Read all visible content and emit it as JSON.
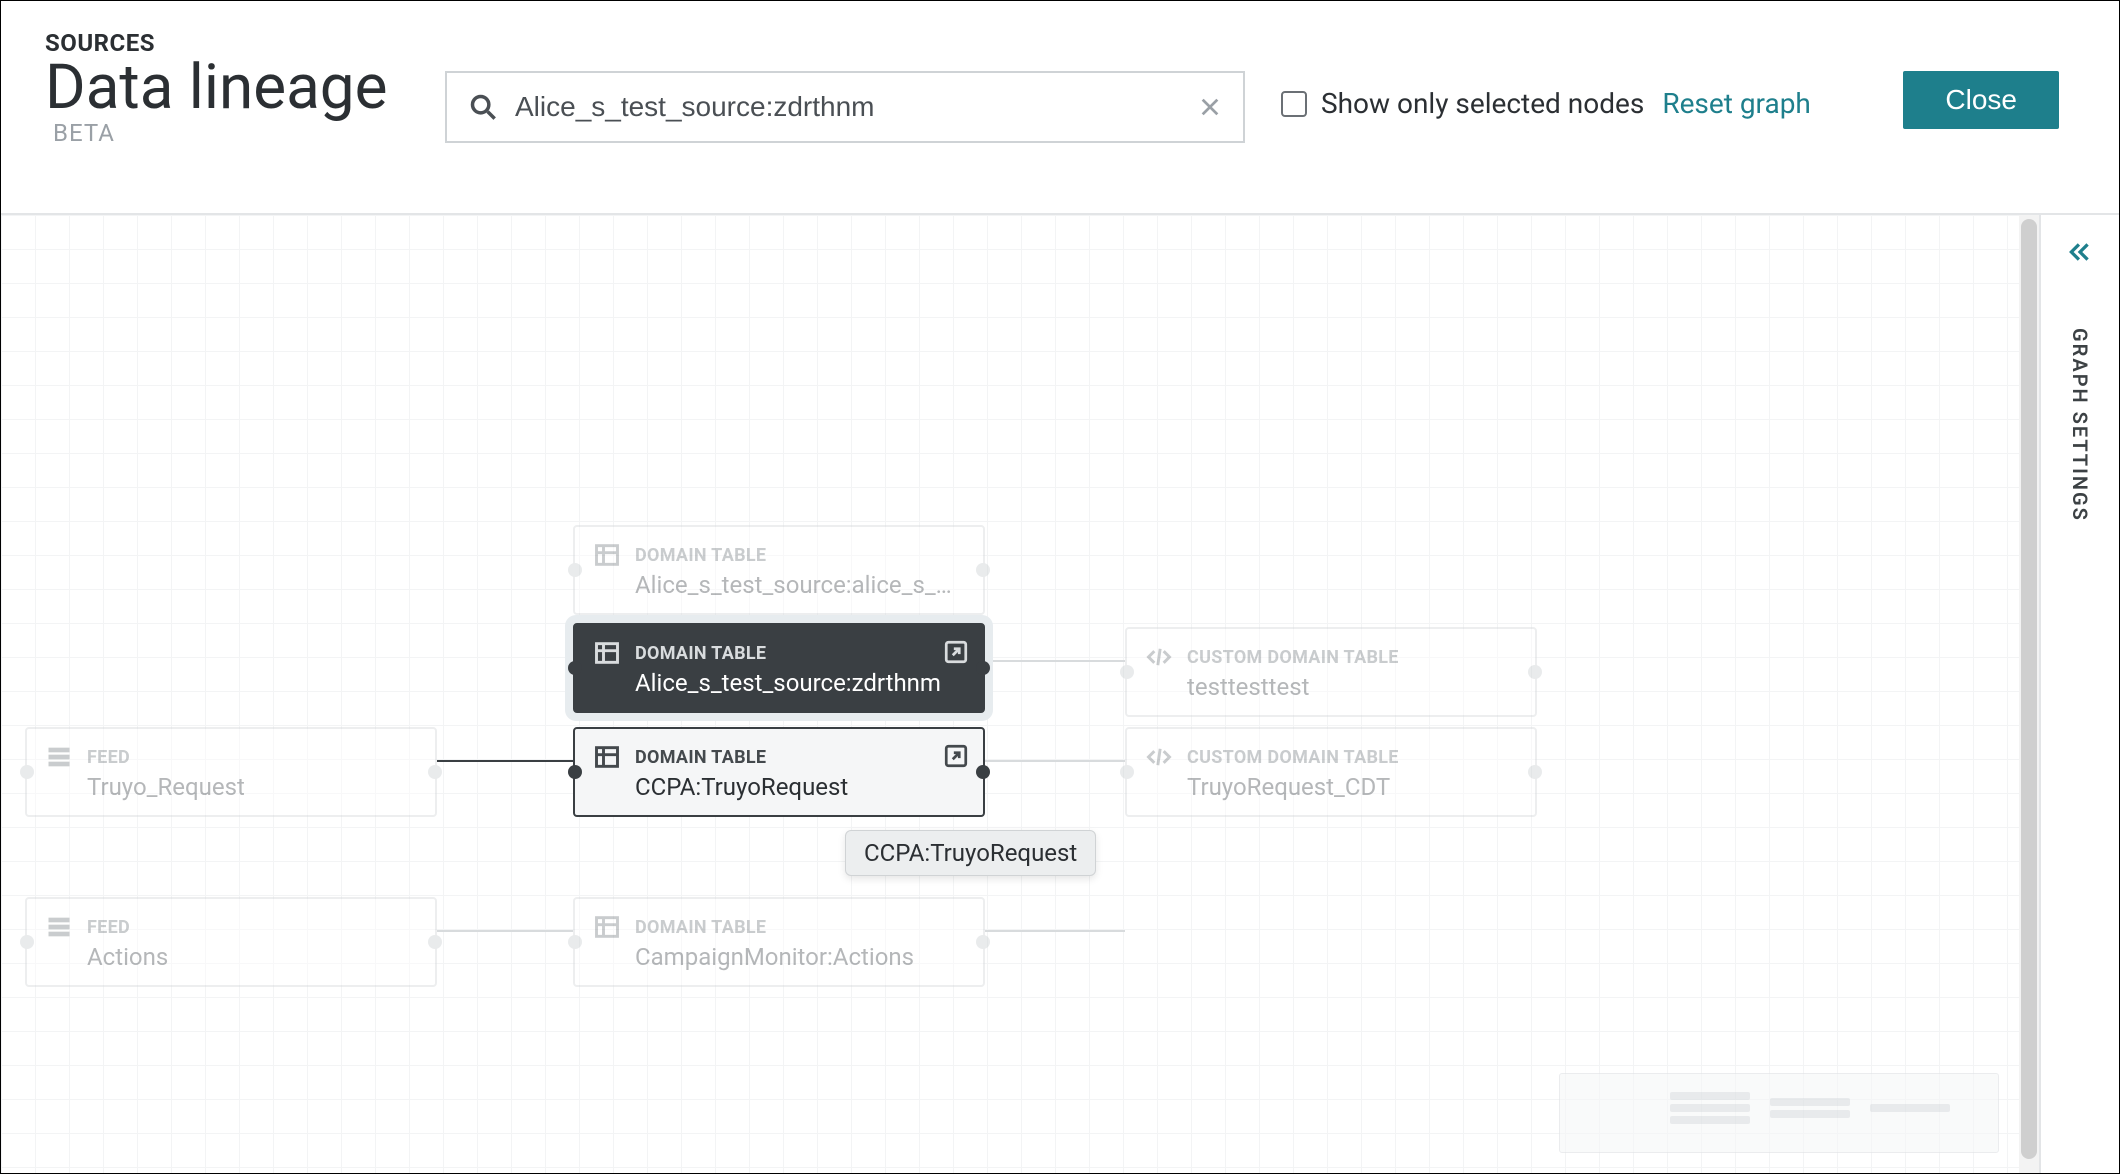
{
  "header": {
    "eyebrow": "SOURCES",
    "title": "Data lineage",
    "beta": "BETA",
    "search_value": "Alice_s_test_source:zdrthnm",
    "show_only_label": "Show only selected nodes",
    "reset_label": "Reset graph",
    "close_label": "Close"
  },
  "side_panel": {
    "label": "GRAPH SETTINGS"
  },
  "tooltip": {
    "text": "CCPA:TruyoRequest"
  },
  "nodes": {
    "feed_truyo": {
      "type": "FEED",
      "name": "Truyo_Request"
    },
    "feed_actions": {
      "type": "FEED",
      "name": "Actions"
    },
    "dt_alice1": {
      "type": "DOMAIN TABLE",
      "name": "Alice_s_test_source:alice_s_…"
    },
    "dt_alice_sel": {
      "type": "DOMAIN TABLE",
      "name": "Alice_s_test_source:zdrthnm"
    },
    "dt_ccpa": {
      "type": "DOMAIN TABLE",
      "name": "CCPA:TruyoRequest"
    },
    "dt_campaign": {
      "type": "DOMAIN TABLE",
      "name": "CampaignMonitor:Actions"
    },
    "cdt_test": {
      "type": "CUSTOM DOMAIN TABLE",
      "name": "testtesttest"
    },
    "cdt_truyo": {
      "type": "CUSTOM DOMAIN TABLE",
      "name": "TruyoRequest_CDT"
    }
  }
}
